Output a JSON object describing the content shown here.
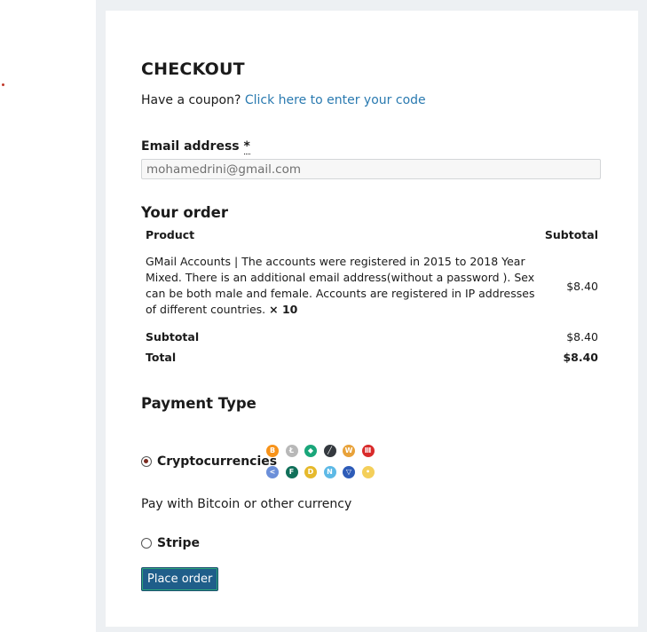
{
  "checkout": {
    "title": "CHECKOUT",
    "coupon_prompt": "Have a coupon? ",
    "coupon_link": "Click here to enter your code"
  },
  "email": {
    "label": "Email address ",
    "required_mark": "*",
    "value": "mohamedrini@gmail.com"
  },
  "order": {
    "title": "Your order",
    "headers": {
      "product": "Product",
      "subtotal": "Subtotal"
    },
    "item": {
      "name": "GMail Accounts | The accounts were registered in 2015 to 2018 Year Mixed. There is an additional email address(without a password ). Sex can be both male and female. Accounts are registered in IP addresses of different countries.",
      "quantity": "× 10",
      "amount": "$8.40"
    },
    "subtotal_label": "Subtotal",
    "subtotal_amount": "$8.40",
    "total_label": "Total",
    "total_amount": "$8.40"
  },
  "payment": {
    "title": "Payment Type",
    "crypto_label": "Cryptocurrencies",
    "crypto_selected": true,
    "crypto_description": "Pay with Bitcoin or other currency",
    "stripe_label": "Stripe",
    "stripe_selected": false,
    "coins": [
      {
        "name": "bitcoin-icon",
        "glyph": "B",
        "color": "#f7931a"
      },
      {
        "name": "litecoin-icon",
        "glyph": "Ł",
        "color": "#b8b8b8"
      },
      {
        "name": "green-coin-icon",
        "glyph": "◆",
        "color": "#1aa67a"
      },
      {
        "name": "pen-coin-icon",
        "glyph": "╱",
        "color": "#34393f"
      },
      {
        "name": "w-coin-icon",
        "glyph": "W",
        "color": "#e8a23a"
      },
      {
        "name": "red-coin-icon",
        "glyph": "Ⅲ",
        "color": "#d92b2b"
      },
      {
        "name": "share-coin-icon",
        "glyph": "<",
        "color": "#6b8fd9"
      },
      {
        "name": "f-coin-icon",
        "glyph": "F",
        "color": "#11705a"
      },
      {
        "name": "dogecoin-icon",
        "glyph": "D",
        "color": "#e6b92c"
      },
      {
        "name": "n-coin-icon",
        "glyph": "N",
        "color": "#5db9e6"
      },
      {
        "name": "triangle-coin-icon",
        "glyph": "▽",
        "color": "#2e5cb8"
      },
      {
        "name": "yellow-coin-icon",
        "glyph": "•",
        "color": "#f4cf5a"
      }
    ]
  },
  "actions": {
    "place_order_label": "Place order"
  }
}
